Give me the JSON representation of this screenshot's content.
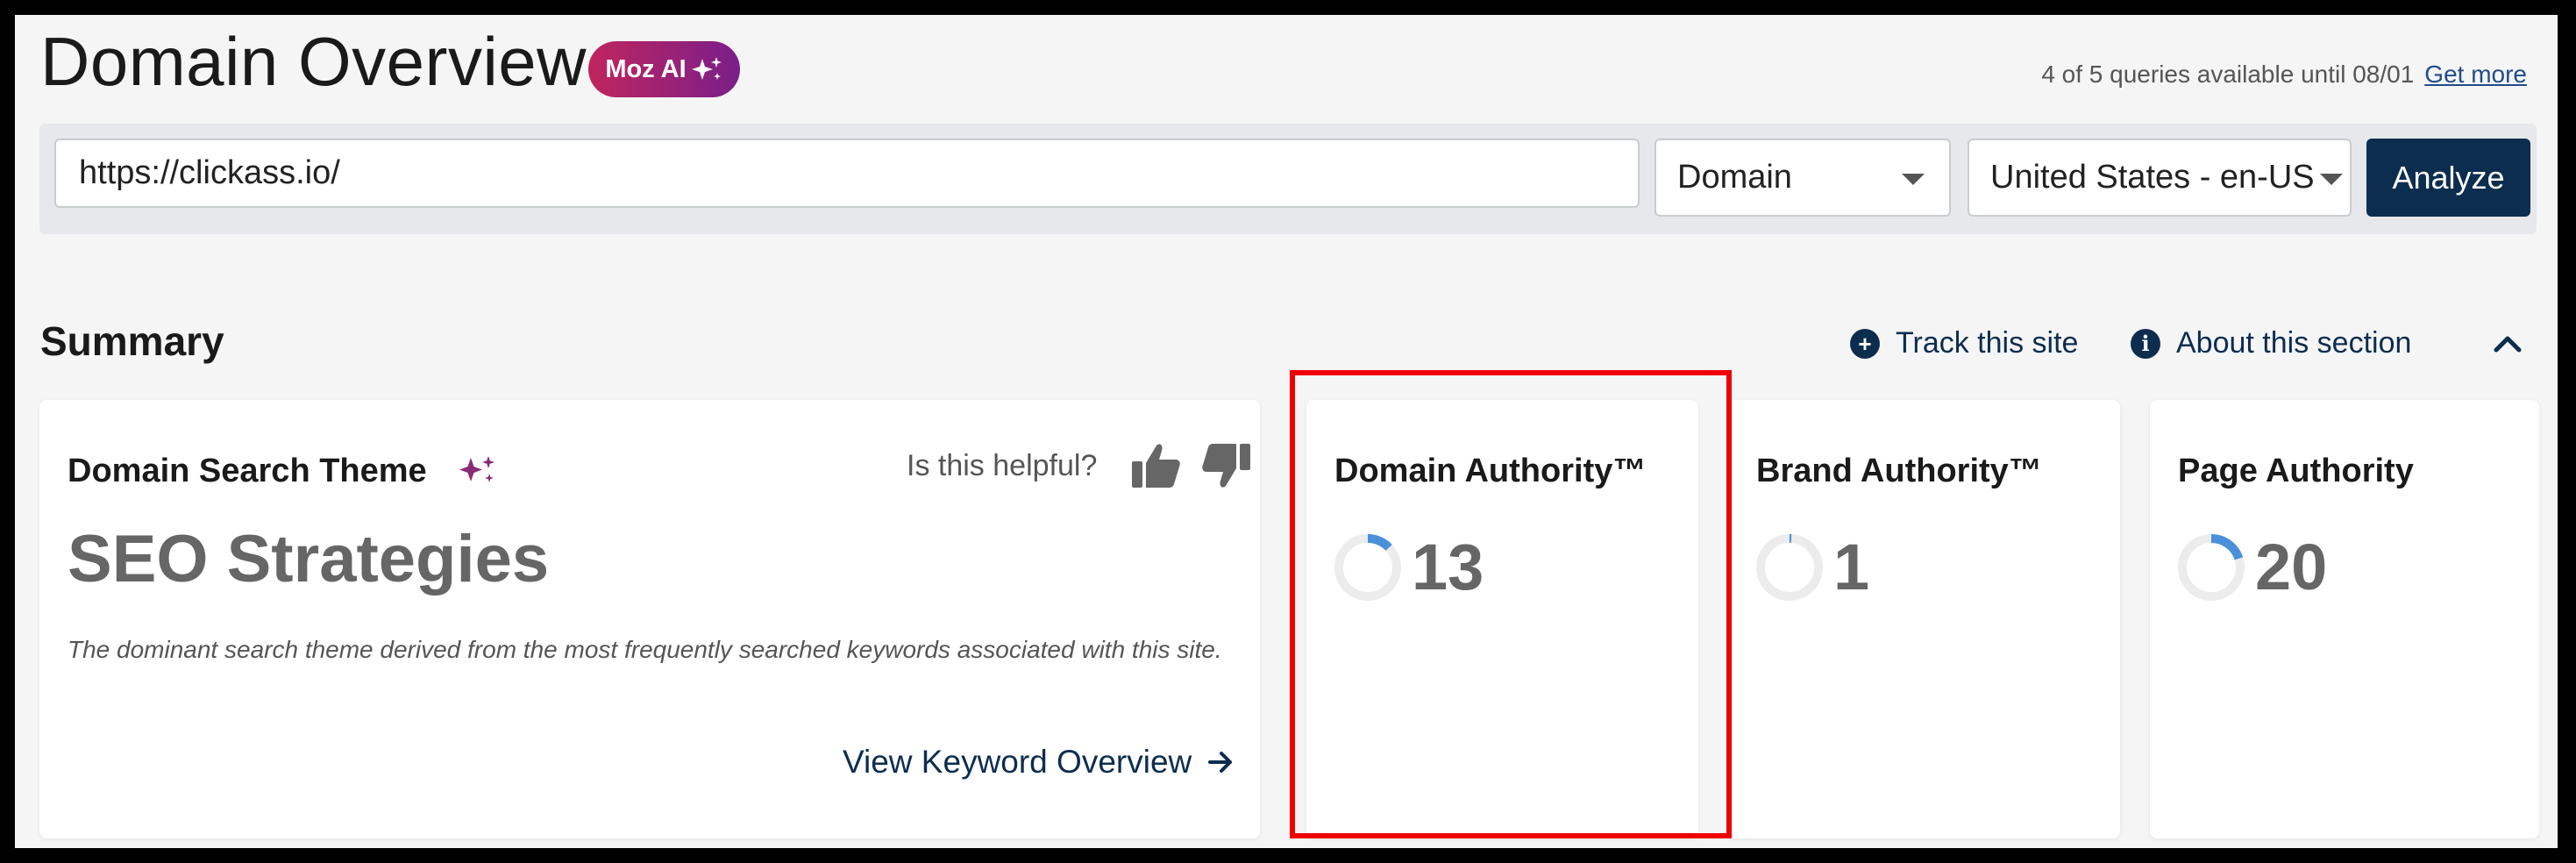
{
  "header": {
    "title": "Domain Overview",
    "badge_label": "Moz AI",
    "badge_icon": "sparkle-icon",
    "queries_text": "4 of 5 queries available until 08/01",
    "get_more_label": "Get more"
  },
  "search": {
    "url_value": "https://clickass.io/",
    "scope_value": "Domain",
    "locale_value": "United States - en-US",
    "analyze_label": "Analyze"
  },
  "summary": {
    "title": "Summary",
    "track_label": "Track this site",
    "about_label": "About this section"
  },
  "theme_card": {
    "title": "Domain Search Theme",
    "helpful_label": "Is this helpful?",
    "value": "SEO Strategies",
    "description": "The dominant search theme derived from the most frequently searched keywords associated with this site.",
    "link_label": "View Keyword Overview"
  },
  "metrics": [
    {
      "title": "Domain Authority™",
      "value": "13",
      "score": 13
    },
    {
      "title": "Brand Authority™",
      "value": "1",
      "score": 1
    },
    {
      "title": "Page Authority",
      "value": "20",
      "score": 20
    }
  ],
  "colors": {
    "brand_navy": "#0d2d4f",
    "badge_start": "#c0255e",
    "badge_end": "#7a1f8a",
    "gauge_fill": "#4a90d9",
    "gauge_track": "#ececec",
    "highlight": "#e00000"
  }
}
